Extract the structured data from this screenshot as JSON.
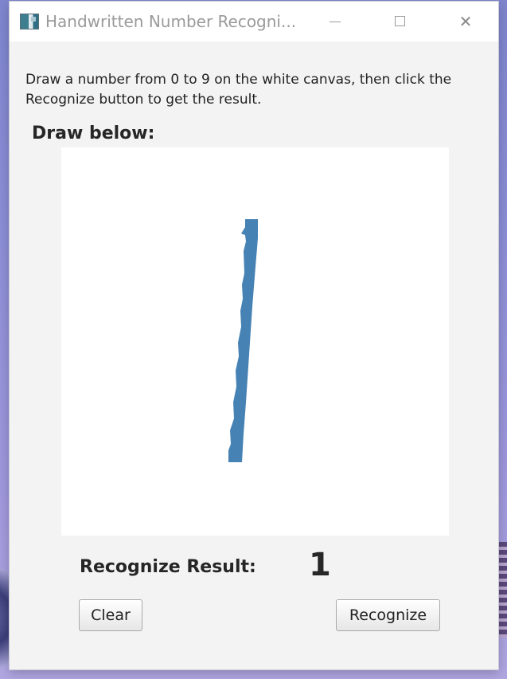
{
  "window": {
    "title": "Handwritten Number Recogni...",
    "close_glyph": "✕"
  },
  "content": {
    "instructions": "Draw a number from 0 to 9 on the white canvas, then click the Recognize button to get the result.",
    "draw_label": "Draw below:",
    "canvas_stroke_color": "#4682b4",
    "canvas_background": "#ffffff"
  },
  "result": {
    "label": "Recognize Result:",
    "value": "1"
  },
  "buttons": {
    "clear_label": "Clear",
    "recognize_label": "Recognize"
  },
  "icons": {
    "app": "app-icon",
    "minimize": "minimize-icon",
    "maximize": "maximize-icon",
    "close": "close-icon"
  }
}
